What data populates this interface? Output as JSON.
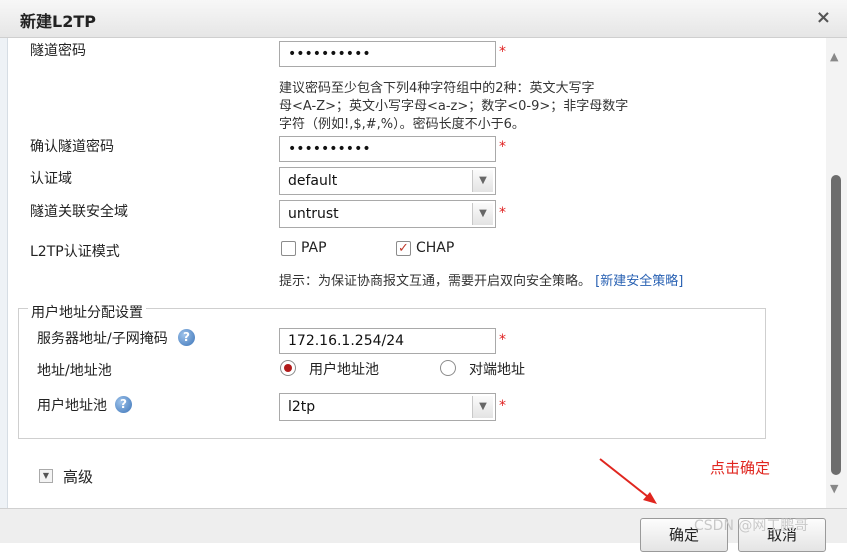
{
  "dialog": {
    "title": "新建L2TP",
    "close_symbol": "×"
  },
  "form": {
    "tunnel_password": {
      "label": "隧道密码",
      "value": "••••••••••",
      "required": "*"
    },
    "password_hint": [
      "建议密码至少包含下列4种字符组中的2种：英文大写字",
      "母<A-Z>；英文小写字母<a-z>；数字<0-9>；非字母数字",
      "字符（例如!,$,#,%）。密码长度不小于6。"
    ],
    "confirm_password": {
      "label": "确认隧道密码",
      "value": "••••••••••",
      "required": "*"
    },
    "auth_domain": {
      "label": "认证域",
      "value": "default"
    },
    "security_zone": {
      "label": "隧道关联安全域",
      "value": "untrust",
      "required": "*"
    },
    "auth_mode": {
      "label": "L2TP认证模式",
      "options": [
        {
          "label": "PAP",
          "checked": false
        },
        {
          "label": "CHAP",
          "checked": true
        }
      ],
      "check_symbol": "✓"
    },
    "policy_tip": {
      "text": "提示：为保证协商报文互通，需要开启双向安全策略。",
      "link": "[新建安全策略]"
    }
  },
  "address_allocation": {
    "legend": "用户地址分配设置",
    "server_address": {
      "label": "服务器地址/子网掩码",
      "value": "172.16.1.254/24",
      "required": "*"
    },
    "address_type": {
      "label": "地址/地址池",
      "options": [
        {
          "label": "用户地址池",
          "checked": true
        },
        {
          "label": "对端地址",
          "checked": false
        }
      ]
    },
    "user_pool": {
      "label": "用户地址池",
      "value": "l2tp",
      "required": "*"
    },
    "help_symbol": "?"
  },
  "advanced": {
    "label": "高级",
    "toggle_symbol": "▼"
  },
  "footer": {
    "ok_label": "确定",
    "cancel_label": "取消"
  },
  "annotation": {
    "text": "点击确定",
    "color": "#e0261f"
  },
  "watermark": "CSDN @网工鹏哥",
  "scroll": {
    "up_symbol": "▲",
    "down_symbol": "▼"
  }
}
